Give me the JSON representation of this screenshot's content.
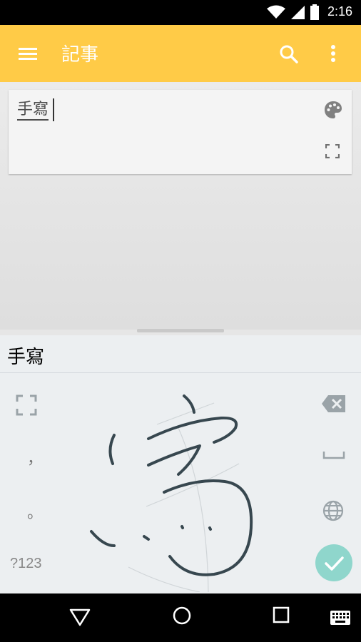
{
  "status_bar": {
    "time": "2:16"
  },
  "app_bar": {
    "title": "記事"
  },
  "note": {
    "text": "手寫"
  },
  "candidate_bar": {
    "candidates": [
      "手寫"
    ]
  },
  "keyboard": {
    "comma": "，",
    "period": "。",
    "numbers_key": "?123"
  },
  "colors": {
    "app_bar": "#ffcb47",
    "done_button": "#8fd6cc",
    "ink": "#37474f"
  },
  "icons": [
    "wifi-icon",
    "signal-icon",
    "battery-icon",
    "menu-icon",
    "search-icon",
    "more-vert-icon",
    "palette-icon",
    "fullscreen-icon",
    "backspace-icon",
    "space-icon",
    "globe-icon",
    "check-icon",
    "back-icon",
    "home-icon",
    "recents-icon",
    "keyboard-icon"
  ]
}
